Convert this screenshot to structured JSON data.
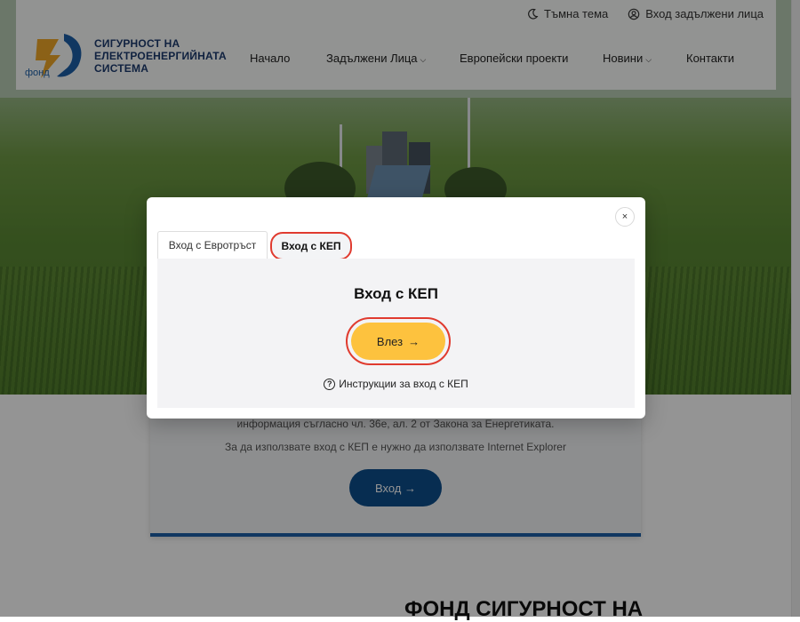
{
  "header": {
    "topbar": {
      "dark_theme": "Тъмна тема",
      "login": "Вход задължени лица"
    },
    "logo": {
      "line1": "СИГУРНОСТ НА",
      "line2": "ЕЛЕКТРОЕНЕРГИЙНАТА",
      "line3": "СИСТЕМА",
      "fond": "фонд"
    },
    "nav": {
      "home": "Начало",
      "obliged": "Задължени Лица",
      "eu_projects": "Европейски проекти",
      "news": "Новини",
      "contacts": "Контакти"
    }
  },
  "card": {
    "line1": "информация съгласно чл. 36е, ал. 2 от Закона за Енергетиката.",
    "line2": "За да използвате вход с КЕП е нужно да използвате Internet Explorer",
    "button": "Вход"
  },
  "page_heading": "ФОНД СИГУРНОСТ НА",
  "modal": {
    "close_glyph": "×",
    "tabs": [
      "Вход с Евротръст",
      "Вход с КЕП"
    ],
    "active_tab": "Вход с КЕП",
    "title": "Вход с КЕП",
    "enter_button": "Влез",
    "help_link": "Инструкции за вход с КЕП"
  },
  "colors": {
    "accent_yellow": "#fdc23e",
    "primary_blue": "#0d4f8c",
    "highlight_red": "#e03b2f"
  }
}
